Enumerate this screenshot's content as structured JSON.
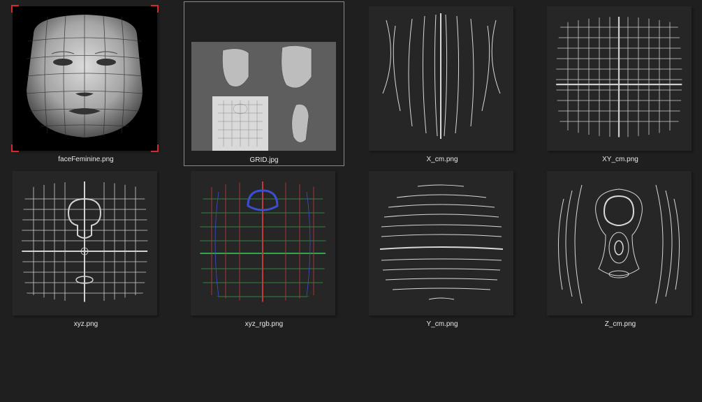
{
  "files": [
    {
      "name": "faceFeminine.png",
      "icon": "face-render-thumbnail"
    },
    {
      "name": "GRID.jpg",
      "icon": "grid-composite-thumbnail"
    },
    {
      "name": "X_cm.png",
      "icon": "x-lines-thumbnail"
    },
    {
      "name": "XY_cm.png",
      "icon": "xy-grid-thumbnail"
    },
    {
      "name": "xyz.png",
      "icon": "xyz-grid-thumbnail"
    },
    {
      "name": "xyz_rgb.png",
      "icon": "xyz-rgb-thumbnail"
    },
    {
      "name": "Y_cm.png",
      "icon": "y-lines-thumbnail"
    },
    {
      "name": "Z_cm.png",
      "icon": "z-contours-thumbnail"
    }
  ],
  "selected_index": 1,
  "colors": {
    "background": "#1f1f1f",
    "thumb_bg": "#262626",
    "selection_corner": "#d62a2a",
    "selection_border": "#8a8a8a"
  }
}
